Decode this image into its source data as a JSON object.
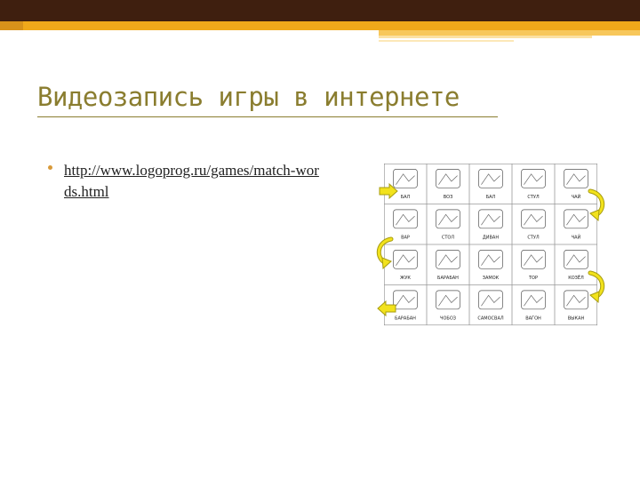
{
  "slide": {
    "title": "Видеозапись игры в интернете",
    "link_text": "http://www.logoprog.ru/games/match-words.html"
  },
  "worksheet": {
    "rows": [
      [
        "БАЛ",
        "ВОЗ",
        "БАЛ",
        "СТУЛ",
        "ЧАЙ"
      ],
      [
        "ВАР",
        "СТОЛ",
        "ДИВАН",
        "СТУЛ",
        "ЧАЙ"
      ],
      [
        "ЖУК",
        "БАРАБАН",
        "ЗАМОК",
        "ТОР",
        "КОЗЁЛ"
      ],
      [
        "БАРАБАН",
        "ЧОБОЗ",
        "САМОСВАЛ",
        "ВАГОН",
        "ВЫКАН"
      ]
    ]
  },
  "colors": {
    "top_band": "#3f1f0f",
    "accent_gold": "#f0a81a",
    "title": "#8a7d2f",
    "bullet": "#d89a3a",
    "arrow_fill": "#f2e21c",
    "arrow_stroke": "#a79c10"
  }
}
